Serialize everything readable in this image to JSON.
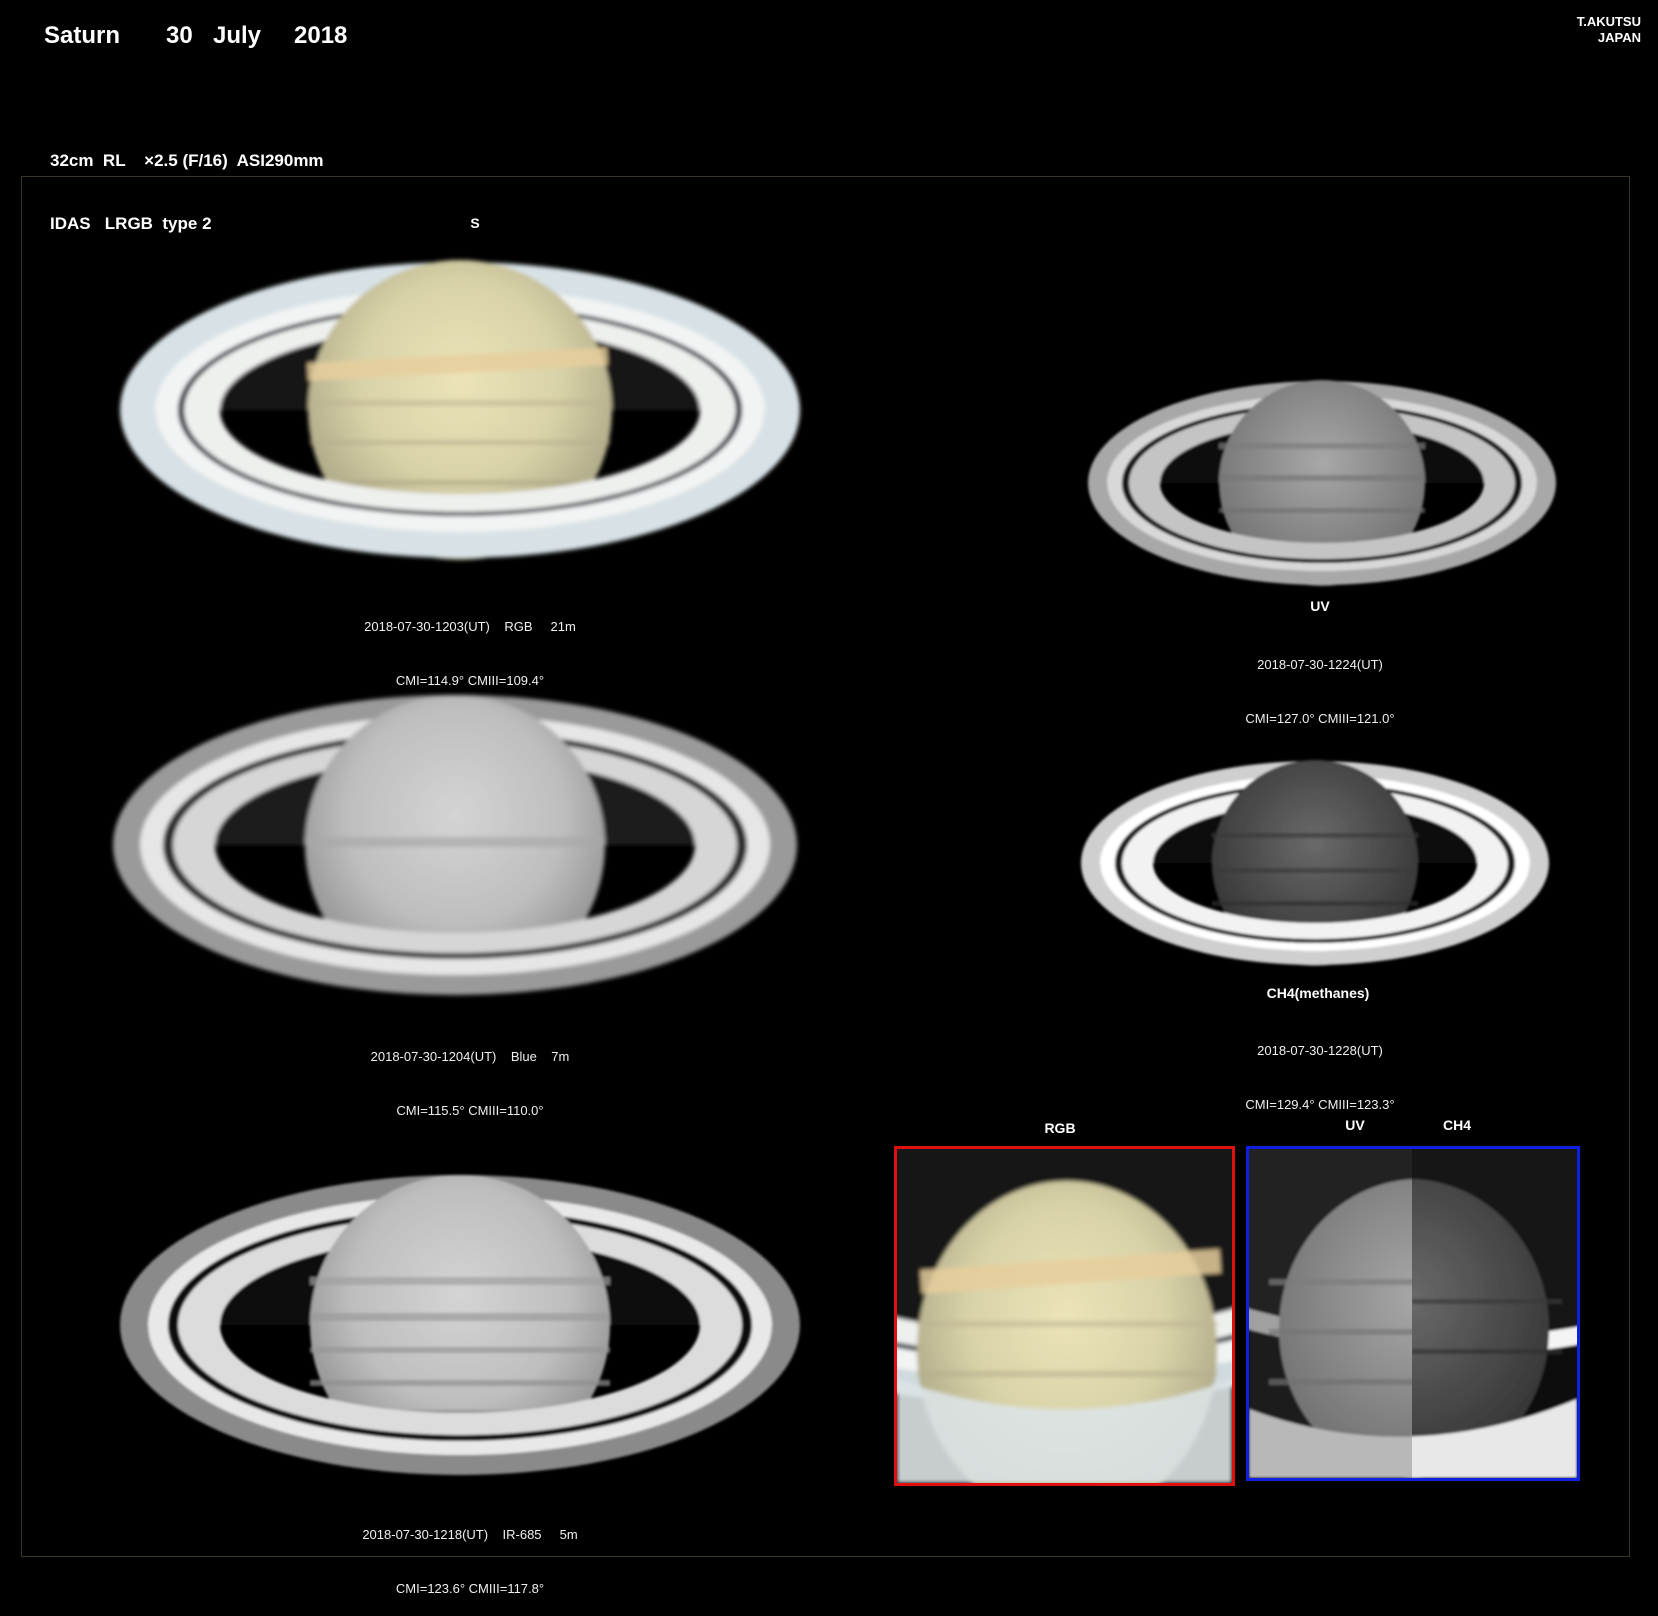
{
  "header": {
    "object": "Saturn",
    "day": "30",
    "month": "July",
    "year": "2018",
    "author_name": "T.AKUTSU",
    "author_country": "JAPAN",
    "spec_line1": "32cm  RL    ×2.5 (F/16)  ASI290mm",
    "spec_line2": "IDAS   LRGB  type 2"
  },
  "south_marker": "S",
  "panels": {
    "rgb": {
      "caption1": "2018-07-30-1203(UT)    RGB     21m",
      "caption2": "CMI=114.9° CMIII=109.4°"
    },
    "blue": {
      "caption1": "2018-07-30-1204(UT)    Blue    7m",
      "caption2": "CMI=115.5° CMIII=110.0°"
    },
    "ir": {
      "caption1": "2018-07-30-1218(UT)    IR-685     5m",
      "caption2": "CMI=123.6° CMIII=117.8°"
    },
    "uv": {
      "label": "UV",
      "caption1": "2018-07-30-1224(UT)",
      "caption2": "CMI=127.0° CMIII=121.0°"
    },
    "ch4": {
      "label": "CH4(methanes)",
      "caption1": "2018-07-30-1228(UT)",
      "caption2": "CMI=129.4° CMIII=123.3°"
    }
  },
  "comparison": {
    "rgb_label": "RGB",
    "uv_label": "UV",
    "ch4_label": "CH4",
    "rgb_box_color": "#e01010",
    "uvch4_box_color": "#1020e0"
  }
}
